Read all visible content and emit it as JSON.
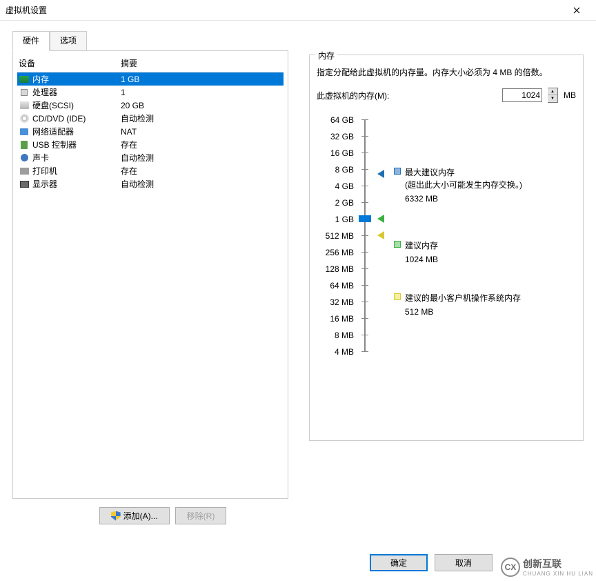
{
  "window": {
    "title": "虚拟机设置"
  },
  "tabs": {
    "hardware": "硬件",
    "options": "选项"
  },
  "table": {
    "col_device": "设备",
    "col_summary": "摘要",
    "rows": [
      {
        "name": "内存",
        "summary": "1 GB",
        "icon": "memory-icon",
        "selected": true
      },
      {
        "name": "处理器",
        "summary": "1",
        "icon": "cpu-icon"
      },
      {
        "name": "硬盘(SCSI)",
        "summary": "20 GB",
        "icon": "hdd-icon"
      },
      {
        "name": "CD/DVD (IDE)",
        "summary": "自动检测",
        "icon": "cd-icon"
      },
      {
        "name": "网络适配器",
        "summary": "NAT",
        "icon": "network-icon"
      },
      {
        "name": "USB 控制器",
        "summary": "存在",
        "icon": "usb-icon"
      },
      {
        "name": "声卡",
        "summary": "自动检测",
        "icon": "sound-icon"
      },
      {
        "name": "打印机",
        "summary": "存在",
        "icon": "printer-icon"
      },
      {
        "name": "显示器",
        "summary": "自动检测",
        "icon": "display-icon"
      }
    ]
  },
  "buttons": {
    "add": "添加(A)...",
    "remove": "移除(R)"
  },
  "memory": {
    "group_title": "内存",
    "description": "指定分配给此虚拟机的内存量。内存大小必须为 4 MB 的倍数。",
    "input_label": "此虚拟机的内存(M):",
    "value": "1024",
    "unit": "MB",
    "ticks": [
      "64 GB",
      "32 GB",
      "16 GB",
      "8 GB",
      "4 GB",
      "2 GB",
      "1 GB",
      "512 MB",
      "256 MB",
      "128 MB",
      "64 MB",
      "32 MB",
      "16 MB",
      "8 MB",
      "4 MB"
    ],
    "current_index": 6,
    "markers": {
      "max_idx": 3.3,
      "rec_idx": 6.0,
      "min_idx": 7.0
    },
    "legends": {
      "max": {
        "title": "最大建议内存",
        "note": "(超出此大小可能发生内存交换。)",
        "value": "6332 MB"
      },
      "rec": {
        "title": "建议内存",
        "value": "1024 MB"
      },
      "min": {
        "title": "建议的最小客户机操作系统内存",
        "value": "512 MB"
      }
    }
  },
  "footer": {
    "ok": "确定",
    "cancel": "取消"
  },
  "watermark": {
    "cn": "创新互联",
    "en": "CHUANG XIN HU LIAN",
    "logo": "CX"
  }
}
